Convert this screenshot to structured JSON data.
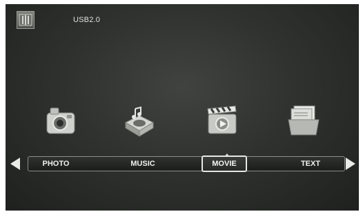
{
  "header": {
    "source_label": "USB2.0",
    "source_icon": "usb-device-icon"
  },
  "media_menu": {
    "items": [
      {
        "label": "PHOTO",
        "icon": "camera-icon"
      },
      {
        "label": "MUSIC",
        "icon": "music-player-icon"
      },
      {
        "label": "MOVIE",
        "icon": "clapperboard-icon"
      },
      {
        "label": "TEXT",
        "icon": "documents-icon"
      }
    ],
    "selected": "MOVIE"
  },
  "navigation": {
    "left": "left-arrow-icon",
    "right": "right-arrow-icon"
  }
}
